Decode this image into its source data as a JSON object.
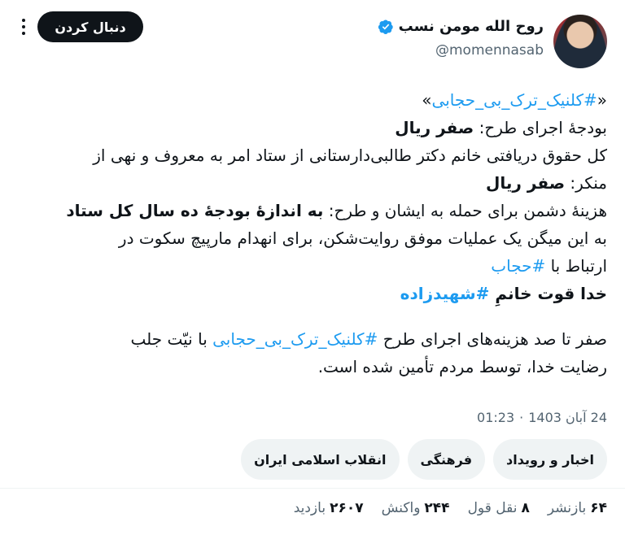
{
  "author": {
    "display_name": "روح الله مومن نسب",
    "handle": "@momennasab",
    "verified_icon": "verified-badge-icon"
  },
  "actions": {
    "follow_label": "دنبال کردن",
    "more_icon": "more-options-icon"
  },
  "tweet": {
    "l1_tag": "#کلنیک_ترک_بی_حجابی",
    "l1_open": "«",
    "l1_close": "»",
    "l2_text": "بودجهٔ اجرای طرح: ",
    "l2_bold": "صفر ریال",
    "l3_text": "کل حقوق دریافتی خانم دکتر طالبی‌دارستانی از ستاد امر به معروف و نهی از",
    "l4_text": "منکر: ",
    "l4_bold": "صفر ریال",
    "l5_text": "هزینهٔ دشمن برای حمله به ایشان و طرح: ",
    "l5_bold": "به اندازهٔ بودجهٔ ده سال کل ستاد",
    "l6_text": "به این میگن یک عملیات موفق روایت‌شکن، برای انهدام مارپیچ سکوت در",
    "l7_text": "ارتباط با ",
    "l7_tag": "#حجاب",
    "l8_text": "خدا قوت خانمِ ",
    "l8_tag": "#شهیدزاده",
    "l9_text": "صفر تا صد هزینه‌های اجرای طرح ",
    "l9_tag": "#کلنیک_ترک_بی_حجابی",
    "l9_text2": " با نیّت جلب",
    "l10_text": "رضایت خدا، توسط مردم تأمین شده است."
  },
  "timestamp": {
    "time": "01:23",
    "sep": "·",
    "date": "24 آبان 1403"
  },
  "chips": [
    {
      "label": "اخبار و رویداد"
    },
    {
      "label": "فرهنگی"
    },
    {
      "label": "انقلاب اسلامی ایران"
    }
  ],
  "stats": {
    "reposts_num": "۶۴",
    "reposts_label": "بازنشر",
    "quotes_num": "۸",
    "quotes_label": "نقل قول",
    "likes_num": "۲۴۴",
    "likes_label": "واکنش",
    "views_num": "۲۶۰۷",
    "views_label": "بازدید"
  },
  "colors": {
    "link": "#1d9bf0",
    "text": "#0f1419",
    "muted": "#536471",
    "chip_bg": "#eff3f4",
    "button_bg": "#0f1419"
  }
}
